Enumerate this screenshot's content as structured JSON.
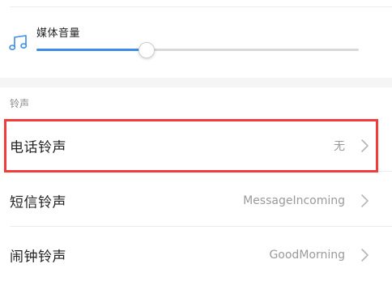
{
  "volume": {
    "icon": "music-note-icon",
    "label": "媒体音量",
    "level_fraction": 0.34,
    "accent_color": "#3a8ee6"
  },
  "ringtone_section": {
    "header": "铃声",
    "rows": [
      {
        "label": "电话铃声",
        "value": "无",
        "icon": "chevron-right-icon"
      },
      {
        "label": "短信铃声",
        "value": "MessageIncoming",
        "icon": "chevron-right-icon"
      },
      {
        "label": "闹钟铃声",
        "value": "GoodMorning",
        "icon": "chevron-right-icon"
      }
    ]
  },
  "highlight": {
    "target": "电话铃声",
    "color": "#f23b3b"
  }
}
